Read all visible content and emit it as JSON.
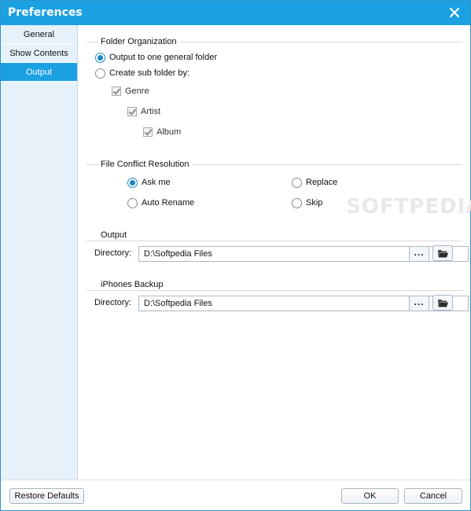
{
  "window": {
    "title": "Preferences"
  },
  "sidebar": {
    "items": [
      {
        "label": "General",
        "active": false
      },
      {
        "label": "Show Contents",
        "active": false
      },
      {
        "label": "Output",
        "active": true
      }
    ]
  },
  "folder_organization": {
    "title": "Folder Organization",
    "option_general": "Output to one general folder",
    "option_sub": "Create sub folder by:",
    "selected": "general",
    "genre": "Genre",
    "artist": "Artist",
    "album": "Album"
  },
  "file_conflict": {
    "title": "File Conflict Resolution",
    "ask_me": "Ask me",
    "auto_rename": "Auto Rename",
    "replace": "Replace",
    "skip": "Skip",
    "selected": "ask_me"
  },
  "output": {
    "title": "Output",
    "directory_label": "Directory:",
    "directory_value": "D:\\Softpedia Files",
    "browse_label": "..."
  },
  "iphones_backup": {
    "title": "iPhones Backup",
    "directory_label": "Directory:",
    "directory_value": "D:\\Softpedia Files",
    "browse_label": "..."
  },
  "watermark": "SOFTPEDIA",
  "footer": {
    "restore_label": "Restore Defaults",
    "ok_label": "OK",
    "cancel_label": "Cancel"
  },
  "colors": {
    "accent": "#1ba1e2",
    "sidebar_bg": "#e6f1fa",
    "radio_checked": "#1b87c8"
  },
  "icons": {
    "close": "close-icon",
    "folder": "folder-open-icon"
  }
}
